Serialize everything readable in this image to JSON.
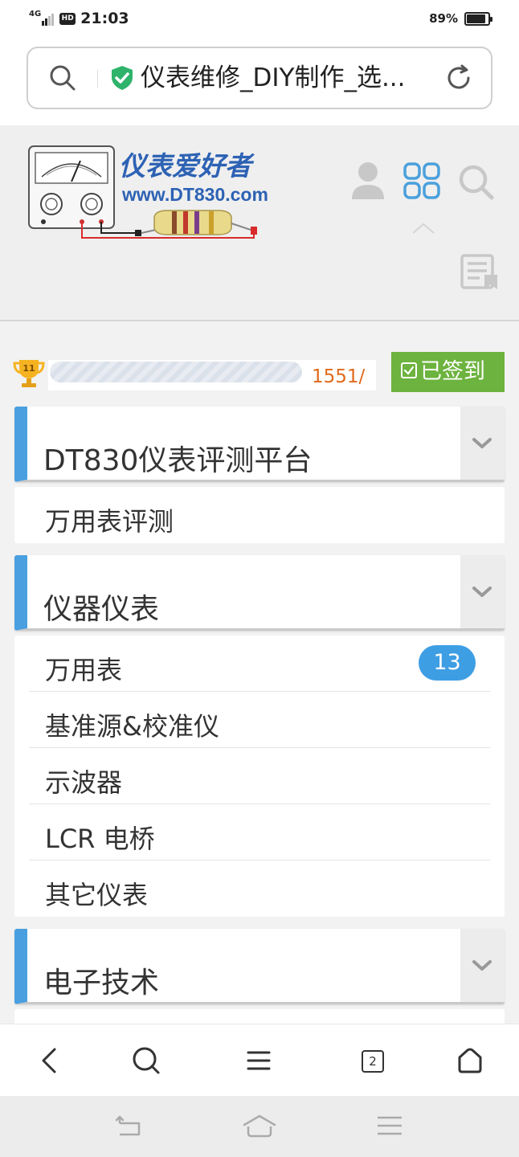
{
  "status_bar": {
    "network": "4G",
    "hd": "HD",
    "time": "21:03",
    "battery_percent": "89%",
    "battery_level": 0.89
  },
  "browser": {
    "url_title": "仪表维修_DIY制作_选...",
    "search_icon": "search-icon",
    "secure_icon": "shield-check-icon",
    "reload_icon": "reload-icon"
  },
  "site_header": {
    "logo_title": "仪表爱好者",
    "logo_url": "www.DT830.com",
    "icons": [
      "user-icon",
      "grid-menu-icon",
      "search-icon",
      "posts-icon"
    ]
  },
  "level": {
    "badge_number": "11",
    "points_text": "1551/",
    "progress_fraction": 0.0,
    "sign_label": "已签到",
    "accent": "#6db33f",
    "points_color": "#e06a1b"
  },
  "sections": [
    {
      "title": "DT830仪表评测平台",
      "items": [
        {
          "label": "万用表评测",
          "badge": ""
        }
      ]
    },
    {
      "title": "仪器仪表",
      "items": [
        {
          "label": "万用表",
          "badge": "13"
        },
        {
          "label": "基准源&校准仪",
          "badge": ""
        },
        {
          "label": "示波器",
          "badge": ""
        },
        {
          "label": "LCR 电桥",
          "badge": ""
        },
        {
          "label": "其它仪表",
          "badge": ""
        }
      ]
    },
    {
      "title": "电子技术",
      "items": []
    }
  ],
  "colors": {
    "section_accent": "#4a9fe0",
    "badge": "#3e9ee4"
  },
  "browser_nav": {
    "tab_count": "2",
    "icons": [
      "back-icon",
      "search-icon",
      "menu-icon",
      "tabs-icon",
      "home-icon"
    ]
  },
  "system_nav": {
    "icons": [
      "back-icon",
      "home-icon",
      "recents-icon"
    ]
  }
}
